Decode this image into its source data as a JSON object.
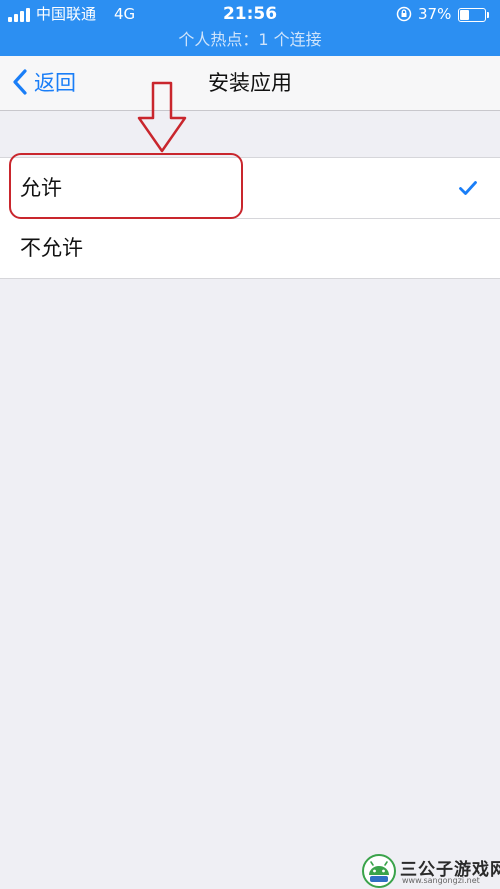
{
  "status_bar": {
    "carrier": "中国联通",
    "network": "4G",
    "time": "21:56",
    "battery_percent": "37%",
    "battery_level": 0.37,
    "hotspot_text": "个人热点：1 个连接"
  },
  "nav": {
    "back_label": "返回",
    "title": "安装应用"
  },
  "options": [
    {
      "label": "允许",
      "selected": true
    },
    {
      "label": "不允许",
      "selected": false
    }
  ],
  "colors": {
    "status_bar_bg": "#2c8ff2",
    "accent_blue": "#1a7ef7",
    "annotation_red": "#c9262d",
    "background": "#efeff4"
  },
  "watermark": {
    "text": "三公子游戏网",
    "url": "www.sangongzi.net"
  }
}
